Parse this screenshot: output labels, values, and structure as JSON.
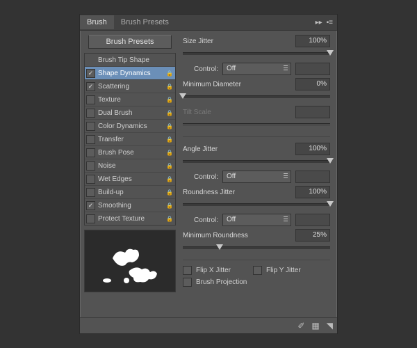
{
  "tabs": {
    "brush": "Brush",
    "presets": "Brush Presets"
  },
  "presets_button": "Brush Presets",
  "options": [
    {
      "label": "Brush Tip Shape",
      "checked": null,
      "locked": false
    },
    {
      "label": "Shape Dynamics",
      "checked": true,
      "locked": true,
      "selected": true
    },
    {
      "label": "Scattering",
      "checked": true,
      "locked": true
    },
    {
      "label": "Texture",
      "checked": false,
      "locked": true
    },
    {
      "label": "Dual Brush",
      "checked": false,
      "locked": true
    },
    {
      "label": "Color Dynamics",
      "checked": false,
      "locked": true
    },
    {
      "label": "Transfer",
      "checked": false,
      "locked": true
    },
    {
      "label": "Brush Pose",
      "checked": false,
      "locked": true
    },
    {
      "label": "Noise",
      "checked": false,
      "locked": true
    },
    {
      "label": "Wet Edges",
      "checked": false,
      "locked": true
    },
    {
      "label": "Build-up",
      "checked": false,
      "locked": true
    },
    {
      "label": "Smoothing",
      "checked": true,
      "locked": true
    },
    {
      "label": "Protect Texture",
      "checked": false,
      "locked": true
    }
  ],
  "settings": {
    "size_jitter": {
      "label": "Size Jitter",
      "value": "100%",
      "pos": 100
    },
    "control1": {
      "label": "Control:",
      "value": "Off"
    },
    "min_diameter": {
      "label": "Minimum Diameter",
      "value": "0%",
      "pos": 0
    },
    "tilt_scale": {
      "label": "Tilt Scale",
      "value": "",
      "disabled": true
    },
    "angle_jitter": {
      "label": "Angle Jitter",
      "value": "100%",
      "pos": 100
    },
    "control2": {
      "label": "Control:",
      "value": "Off"
    },
    "roundness_jitter": {
      "label": "Roundness Jitter",
      "value": "100%",
      "pos": 100
    },
    "control3": {
      "label": "Control:",
      "value": "Off"
    },
    "min_roundness": {
      "label": "Minimum Roundness",
      "value": "25%",
      "pos": 25
    },
    "flip_x": {
      "label": "Flip X Jitter",
      "checked": false
    },
    "flip_y": {
      "label": "Flip Y Jitter",
      "checked": false
    },
    "brush_proj": {
      "label": "Brush Projection",
      "checked": false
    }
  }
}
